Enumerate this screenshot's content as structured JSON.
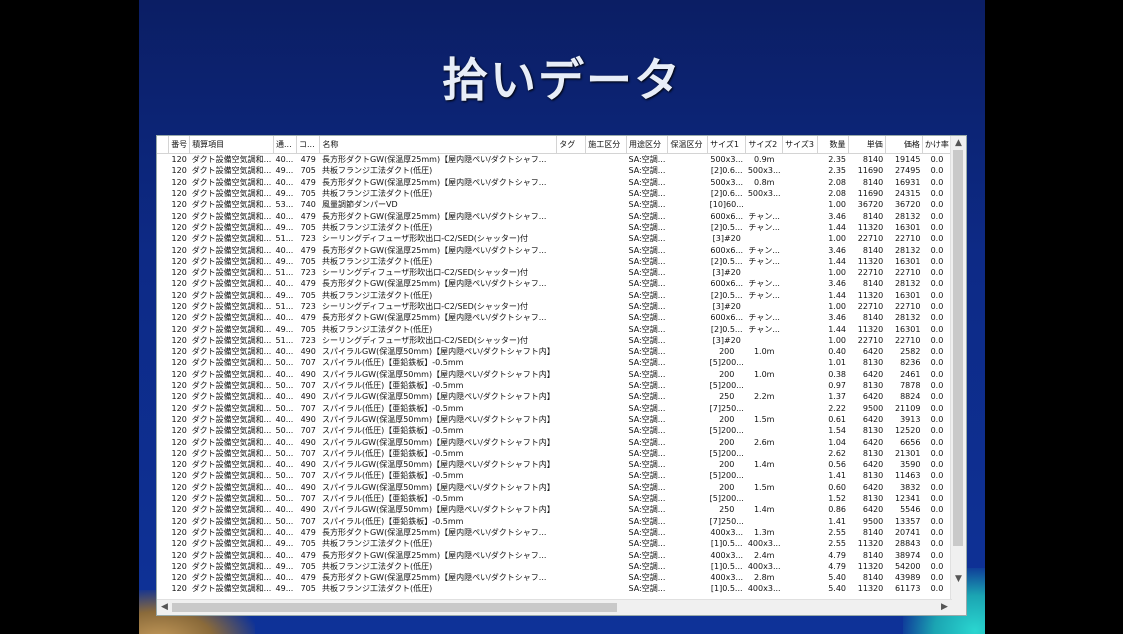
{
  "slide": {
    "title": "拾いデータ"
  },
  "table": {
    "columns": [
      "番号",
      "積算項目",
      "通...",
      "コ...",
      "名称",
      "タグ",
      "施工区分",
      "用途区分",
      "保温区分",
      "サイズ1",
      "サイズ2",
      "サイズ3",
      "数量",
      "単価",
      "価格",
      "かけ率"
    ],
    "rows": [
      [
        "120",
        "ダクト設備空気調和...",
        "40...",
        "479",
        "長方形ダクトGW(保温厚25mm)【屋内隠ぺい/ダクトシャフ...",
        "",
        "",
        "SA:空調...",
        "",
        "500x3...",
        "0.9m",
        "",
        "2.35",
        "8140",
        "19145",
        "0.0"
      ],
      [
        "120",
        "ダクト設備空気調和...",
        "49...",
        "705",
        "共板フランジ工法ダクト(低圧)",
        "",
        "",
        "SA:空調...",
        "",
        "[2]0.6...",
        "500x3...",
        "",
        "2.35",
        "11690",
        "27495",
        "0.0"
      ],
      [
        "120",
        "ダクト設備空気調和...",
        "40...",
        "479",
        "長方形ダクトGW(保温厚25mm)【屋内隠ぺい/ダクトシャフ...",
        "",
        "",
        "SA:空調...",
        "",
        "500x3...",
        "0.8m",
        "",
        "2.08",
        "8140",
        "16931",
        "0.0"
      ],
      [
        "120",
        "ダクト設備空気調和...",
        "49...",
        "705",
        "共板フランジ工法ダクト(低圧)",
        "",
        "",
        "SA:空調...",
        "",
        "[2]0.6...",
        "500x3...",
        "",
        "2.08",
        "11690",
        "24315",
        "0.0"
      ],
      [
        "120",
        "ダクト設備空気調和...",
        "53...",
        "740",
        "風量調節ダンパーVD",
        "",
        "",
        "SA:空調...",
        "",
        "[10]60...",
        "",
        "",
        "1.00",
        "36720",
        "36720",
        "0.0"
      ],
      [
        "120",
        "ダクト設備空気調和...",
        "40...",
        "479",
        "長方形ダクトGW(保温厚25mm)【屋内隠ぺい/ダクトシャフ...",
        "",
        "",
        "SA:空調...",
        "",
        "600x6...",
        "チャン...",
        "",
        "3.46",
        "8140",
        "28132",
        "0.0"
      ],
      [
        "120",
        "ダクト設備空気調和...",
        "49...",
        "705",
        "共板フランジ工法ダクト(低圧)",
        "",
        "",
        "SA:空調...",
        "",
        "[2]0.5...",
        "チャン...",
        "",
        "1.44",
        "11320",
        "16301",
        "0.0"
      ],
      [
        "120",
        "ダクト設備空気調和...",
        "51...",
        "723",
        "シーリングディフューザ形吹出口-C2/SED(シャッター)付",
        "",
        "",
        "SA:空調...",
        "",
        "[3]#20",
        "",
        "",
        "1.00",
        "22710",
        "22710",
        "0.0"
      ],
      [
        "120",
        "ダクト設備空気調和...",
        "40...",
        "479",
        "長方形ダクトGW(保温厚25mm)【屋内隠ぺい/ダクトシャフ...",
        "",
        "",
        "SA:空調...",
        "",
        "600x6...",
        "チャン...",
        "",
        "3.46",
        "8140",
        "28132",
        "0.0"
      ],
      [
        "120",
        "ダクト設備空気調和...",
        "49...",
        "705",
        "共板フランジ工法ダクト(低圧)",
        "",
        "",
        "SA:空調...",
        "",
        "[2]0.5...",
        "チャン...",
        "",
        "1.44",
        "11320",
        "16301",
        "0.0"
      ],
      [
        "120",
        "ダクト設備空気調和...",
        "51...",
        "723",
        "シーリングディフューザ形吹出口-C2/SED(シャッター)付",
        "",
        "",
        "SA:空調...",
        "",
        "[3]#20",
        "",
        "",
        "1.00",
        "22710",
        "22710",
        "0.0"
      ],
      [
        "120",
        "ダクト設備空気調和...",
        "40...",
        "479",
        "長方形ダクトGW(保温厚25mm)【屋内隠ぺい/ダクトシャフ...",
        "",
        "",
        "SA:空調...",
        "",
        "600x6...",
        "チャン...",
        "",
        "3.46",
        "8140",
        "28132",
        "0.0"
      ],
      [
        "120",
        "ダクト設備空気調和...",
        "49...",
        "705",
        "共板フランジ工法ダクト(低圧)",
        "",
        "",
        "SA:空調...",
        "",
        "[2]0.5...",
        "チャン...",
        "",
        "1.44",
        "11320",
        "16301",
        "0.0"
      ],
      [
        "120",
        "ダクト設備空気調和...",
        "51...",
        "723",
        "シーリングディフューザ形吹出口-C2/SED(シャッター)付",
        "",
        "",
        "SA:空調...",
        "",
        "[3]#20",
        "",
        "",
        "1.00",
        "22710",
        "22710",
        "0.0"
      ],
      [
        "120",
        "ダクト設備空気調和...",
        "40...",
        "479",
        "長方形ダクトGW(保温厚25mm)【屋内隠ぺい/ダクトシャフ...",
        "",
        "",
        "SA:空調...",
        "",
        "600x6...",
        "チャン...",
        "",
        "3.46",
        "8140",
        "28132",
        "0.0"
      ],
      [
        "120",
        "ダクト設備空気調和...",
        "49...",
        "705",
        "共板フランジ工法ダクト(低圧)",
        "",
        "",
        "SA:空調...",
        "",
        "[2]0.5...",
        "チャン...",
        "",
        "1.44",
        "11320",
        "16301",
        "0.0"
      ],
      [
        "120",
        "ダクト設備空気調和...",
        "51...",
        "723",
        "シーリングディフューザ形吹出口-C2/SED(シャッター)付",
        "",
        "",
        "SA:空調...",
        "",
        "[3]#20",
        "",
        "",
        "1.00",
        "22710",
        "22710",
        "0.0"
      ],
      [
        "120",
        "ダクト設備空気調和...",
        "40...",
        "490",
        "スパイラルGW(保温厚50mm)【屋内隠ぺい/ダクトシャフト内】",
        "",
        "",
        "SA:空調...",
        "",
        "200",
        "1.0m",
        "",
        "0.40",
        "6420",
        "2582",
        "0.0"
      ],
      [
        "120",
        "ダクト設備空気調和...",
        "50...",
        "707",
        "スパイラル(低圧)【亜鉛鉄板】-0.5mm",
        "",
        "",
        "SA:空調...",
        "",
        "[5]200...",
        "",
        "",
        "1.01",
        "8130",
        "8236",
        "0.0"
      ],
      [
        "120",
        "ダクト設備空気調和...",
        "40...",
        "490",
        "スパイラルGW(保温厚50mm)【屋内隠ぺい/ダクトシャフト内】",
        "",
        "",
        "SA:空調...",
        "",
        "200",
        "1.0m",
        "",
        "0.38",
        "6420",
        "2461",
        "0.0"
      ],
      [
        "120",
        "ダクト設備空気調和...",
        "50...",
        "707",
        "スパイラル(低圧)【亜鉛鉄板】-0.5mm",
        "",
        "",
        "SA:空調...",
        "",
        "[5]200...",
        "",
        "",
        "0.97",
        "8130",
        "7878",
        "0.0"
      ],
      [
        "120",
        "ダクト設備空気調和...",
        "40...",
        "490",
        "スパイラルGW(保温厚50mm)【屋内隠ぺい/ダクトシャフト内】",
        "",
        "",
        "SA:空調...",
        "",
        "250",
        "2.2m",
        "",
        "1.37",
        "6420",
        "8824",
        "0.0"
      ],
      [
        "120",
        "ダクト設備空気調和...",
        "50...",
        "707",
        "スパイラル(低圧)【亜鉛鉄板】-0.5mm",
        "",
        "",
        "SA:空調...",
        "",
        "[7]250...",
        "",
        "",
        "2.22",
        "9500",
        "21109",
        "0.0"
      ],
      [
        "120",
        "ダクト設備空気調和...",
        "40...",
        "490",
        "スパイラルGW(保温厚50mm)【屋内隠ぺい/ダクトシャフト内】",
        "",
        "",
        "SA:空調...",
        "",
        "200",
        "1.5m",
        "",
        "0.61",
        "6420",
        "3913",
        "0.0"
      ],
      [
        "120",
        "ダクト設備空気調和...",
        "50...",
        "707",
        "スパイラル(低圧)【亜鉛鉄板】-0.5mm",
        "",
        "",
        "SA:空調...",
        "",
        "[5]200...",
        "",
        "",
        "1.54",
        "8130",
        "12520",
        "0.0"
      ],
      [
        "120",
        "ダクト設備空気調和...",
        "40...",
        "490",
        "スパイラルGW(保温厚50mm)【屋内隠ぺい/ダクトシャフト内】",
        "",
        "",
        "SA:空調...",
        "",
        "200",
        "2.6m",
        "",
        "1.04",
        "6420",
        "6656",
        "0.0"
      ],
      [
        "120",
        "ダクト設備空気調和...",
        "50...",
        "707",
        "スパイラル(低圧)【亜鉛鉄板】-0.5mm",
        "",
        "",
        "SA:空調...",
        "",
        "[5]200...",
        "",
        "",
        "2.62",
        "8130",
        "21301",
        "0.0"
      ],
      [
        "120",
        "ダクト設備空気調和...",
        "40...",
        "490",
        "スパイラルGW(保温厚50mm)【屋内隠ぺい/ダクトシャフト内】",
        "",
        "",
        "SA:空調...",
        "",
        "200",
        "1.4m",
        "",
        "0.56",
        "6420",
        "3590",
        "0.0"
      ],
      [
        "120",
        "ダクト設備空気調和...",
        "50...",
        "707",
        "スパイラル(低圧)【亜鉛鉄板】-0.5mm",
        "",
        "",
        "SA:空調...",
        "",
        "[5]200...",
        "",
        "",
        "1.41",
        "8130",
        "11463",
        "0.0"
      ],
      [
        "120",
        "ダクト設備空気調和...",
        "40...",
        "490",
        "スパイラルGW(保温厚50mm)【屋内隠ぺい/ダクトシャフト内】",
        "",
        "",
        "SA:空調...",
        "",
        "200",
        "1.5m",
        "",
        "0.60",
        "6420",
        "3832",
        "0.0"
      ],
      [
        "120",
        "ダクト設備空気調和...",
        "50...",
        "707",
        "スパイラル(低圧)【亜鉛鉄板】-0.5mm",
        "",
        "",
        "SA:空調...",
        "",
        "[5]200...",
        "",
        "",
        "1.52",
        "8130",
        "12341",
        "0.0"
      ],
      [
        "120",
        "ダクト設備空気調和...",
        "40...",
        "490",
        "スパイラルGW(保温厚50mm)【屋内隠ぺい/ダクトシャフト内】",
        "",
        "",
        "SA:空調...",
        "",
        "250",
        "1.4m",
        "",
        "0.86",
        "6420",
        "5546",
        "0.0"
      ],
      [
        "120",
        "ダクト設備空気調和...",
        "50...",
        "707",
        "スパイラル(低圧)【亜鉛鉄板】-0.5mm",
        "",
        "",
        "SA:空調...",
        "",
        "[7]250...",
        "",
        "",
        "1.41",
        "9500",
        "13357",
        "0.0"
      ],
      [
        "120",
        "ダクト設備空気調和...",
        "40...",
        "479",
        "長方形ダクトGW(保温厚25mm)【屋内隠ぺい/ダクトシャフ...",
        "",
        "",
        "SA:空調...",
        "",
        "400x3...",
        "1.3m",
        "",
        "2.55",
        "8140",
        "20741",
        "0.0"
      ],
      [
        "120",
        "ダクト設備空気調和...",
        "49...",
        "705",
        "共板フランジ工法ダクト(低圧)",
        "",
        "",
        "SA:空調...",
        "",
        "[1]0.5...",
        "400x3...",
        "",
        "2.55",
        "11320",
        "28843",
        "0.0"
      ],
      [
        "120",
        "ダクト設備空気調和...",
        "40...",
        "479",
        "長方形ダクトGW(保温厚25mm)【屋内隠ぺい/ダクトシャフ...",
        "",
        "",
        "SA:空調...",
        "",
        "400x3...",
        "2.4m",
        "",
        "4.79",
        "8140",
        "38974",
        "0.0"
      ],
      [
        "120",
        "ダクト設備空気調和...",
        "49...",
        "705",
        "共板フランジ工法ダクト(低圧)",
        "",
        "",
        "SA:空調...",
        "",
        "[1]0.5...",
        "400x3...",
        "",
        "4.79",
        "11320",
        "54200",
        "0.0"
      ],
      [
        "120",
        "ダクト設備空気調和...",
        "40...",
        "479",
        "長方形ダクトGW(保温厚25mm)【屋内隠ぺい/ダクトシャフ...",
        "",
        "",
        "SA:空調...",
        "",
        "400x3...",
        "2.8m",
        "",
        "5.40",
        "8140",
        "43989",
        "0.0"
      ],
      [
        "120",
        "ダクト設備空気調和...",
        "49...",
        "705",
        "共板フランジ工法ダクト(低圧)",
        "",
        "",
        "SA:空調...",
        "",
        "[1]0.5...",
        "400x3...",
        "",
        "5.40",
        "11320",
        "61173",
        "0.0"
      ]
    ]
  },
  "scrollbars": {
    "up": "▲",
    "down": "▼",
    "left": "◀",
    "right": "▶"
  }
}
